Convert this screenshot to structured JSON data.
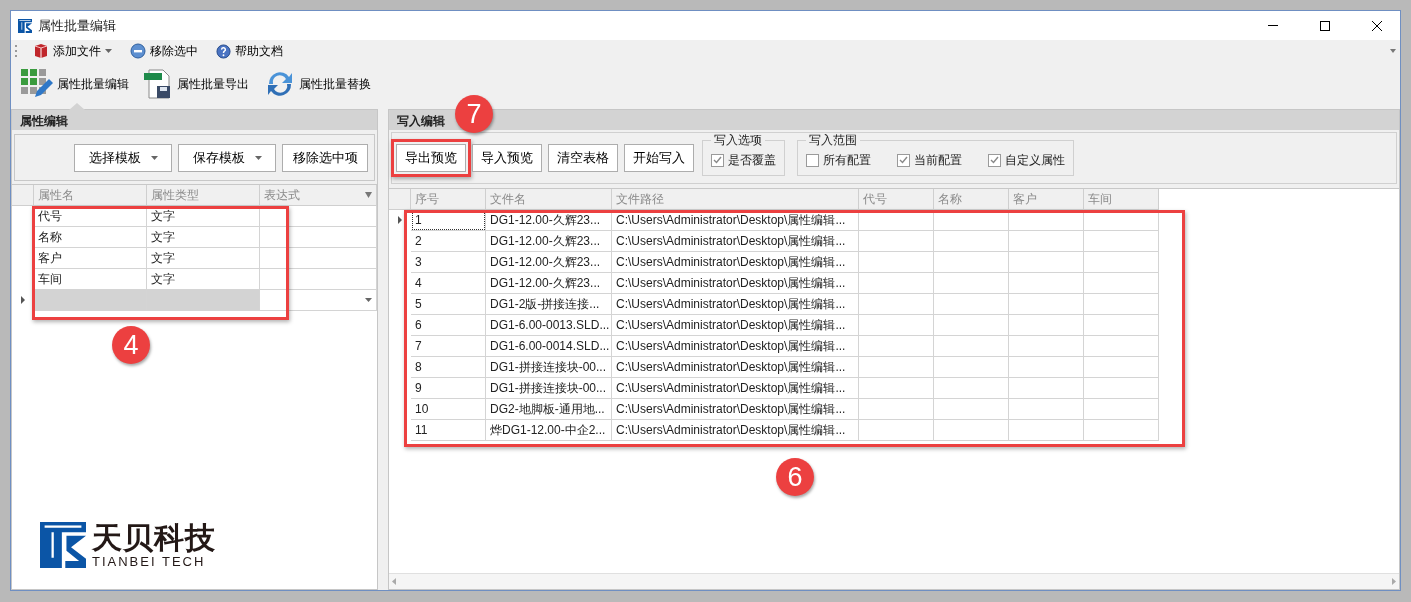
{
  "window": {
    "title": "属性批量编辑"
  },
  "toolbar": [
    {
      "label": "添加文件",
      "kind": "dropdown"
    },
    {
      "label": "移除选中",
      "kind": "remove"
    },
    {
      "label": "帮助文档",
      "kind": "help"
    }
  ],
  "ribbon": [
    {
      "label": "属性批量编辑",
      "kind": "edit",
      "selected": true
    },
    {
      "label": "属性批量导出",
      "kind": "export",
      "selected": false
    },
    {
      "label": "属性批量替换",
      "kind": "replace",
      "selected": false
    }
  ],
  "left_panel": {
    "title": "属性编辑",
    "buttons": [
      {
        "label": "选择模板",
        "kind": "dropdown"
      },
      {
        "label": "保存模板",
        "kind": "dropdown"
      },
      {
        "label": "移除选中项",
        "kind": "plain"
      }
    ],
    "grid": {
      "highlighted": true,
      "columns": [
        "属性名",
        "属性类型",
        "表达式"
      ],
      "rows": [
        {
          "cells": [
            "代号",
            "文字",
            ""
          ],
          "current": false
        },
        {
          "cells": [
            "名称",
            "文字",
            ""
          ],
          "current": false
        },
        {
          "cells": [
            "客户",
            "文字",
            ""
          ],
          "current": false
        },
        {
          "cells": [
            "车间",
            "文字",
            ""
          ],
          "current": false
        }
      ],
      "new_row_current": true
    },
    "logo": {
      "name": "天贝科技",
      "subtitle": "TIANBEI TECH"
    }
  },
  "right_panel": {
    "title": "写入编辑",
    "buttons": [
      {
        "label": "导出预览",
        "highlighted": true
      },
      {
        "label": "导入预览",
        "highlighted": false
      },
      {
        "label": "清空表格",
        "highlighted": false
      },
      {
        "label": "开始写入",
        "highlighted": false
      }
    ],
    "options": {
      "title": "写入选项",
      "items": [
        {
          "label": "是否覆盖",
          "checked": true
        }
      ]
    },
    "scope": {
      "title": "写入范围",
      "items": [
        {
          "label": "所有配置",
          "checked": false
        },
        {
          "label": "当前配置",
          "checked": true
        },
        {
          "label": "自定义属性",
          "checked": true
        }
      ]
    },
    "grid": {
      "highlighted": true,
      "columns": [
        "序号",
        "文件名",
        "文件路径",
        "代号",
        "名称",
        "客户",
        "车间"
      ],
      "rows": [
        {
          "cells": [
            "1",
            "DG1-12.00-久辉23...",
            "C:\\Users\\Administrator\\Desktop\\属性编辑...",
            "",
            "",
            "",
            ""
          ],
          "current": true
        },
        {
          "cells": [
            "2",
            "DG1-12.00-久辉23...",
            "C:\\Users\\Administrator\\Desktop\\属性编辑...",
            "",
            "",
            "",
            ""
          ],
          "current": false
        },
        {
          "cells": [
            "3",
            "DG1-12.00-久辉23...",
            "C:\\Users\\Administrator\\Desktop\\属性编辑...",
            "",
            "",
            "",
            ""
          ],
          "current": false
        },
        {
          "cells": [
            "4",
            "DG1-12.00-久辉23...",
            "C:\\Users\\Administrator\\Desktop\\属性编辑...",
            "",
            "",
            "",
            ""
          ],
          "current": false
        },
        {
          "cells": [
            "5",
            "DG1-2版-拼接连接...",
            "C:\\Users\\Administrator\\Desktop\\属性编辑...",
            "",
            "",
            "",
            ""
          ],
          "current": false
        },
        {
          "cells": [
            "6",
            "DG1-6.00-0013.SLD...",
            "C:\\Users\\Administrator\\Desktop\\属性编辑...",
            "",
            "",
            "",
            ""
          ],
          "current": false
        },
        {
          "cells": [
            "7",
            "DG1-6.00-0014.SLD...",
            "C:\\Users\\Administrator\\Desktop\\属性编辑...",
            "",
            "",
            "",
            ""
          ],
          "current": false
        },
        {
          "cells": [
            "8",
            "DG1-拼接连接块-00...",
            "C:\\Users\\Administrator\\Desktop\\属性编辑...",
            "",
            "",
            "",
            ""
          ],
          "current": false
        },
        {
          "cells": [
            "9",
            "DG1-拼接连接块-00...",
            "C:\\Users\\Administrator\\Desktop\\属性编辑...",
            "",
            "",
            "",
            ""
          ],
          "current": false
        },
        {
          "cells": [
            "10",
            "DG2-地脚板-通用地...",
            "C:\\Users\\Administrator\\Desktop\\属性编辑...",
            "",
            "",
            "",
            ""
          ],
          "current": false
        },
        {
          "cells": [
            "11",
            "烨DG1-12.00-中企2...",
            "C:\\Users\\Administrator\\Desktop\\属性编辑...",
            "",
            "",
            "",
            ""
          ],
          "current": false
        }
      ]
    }
  },
  "callouts": [
    {
      "number": "7"
    },
    {
      "number": "4"
    },
    {
      "number": "6"
    }
  ]
}
